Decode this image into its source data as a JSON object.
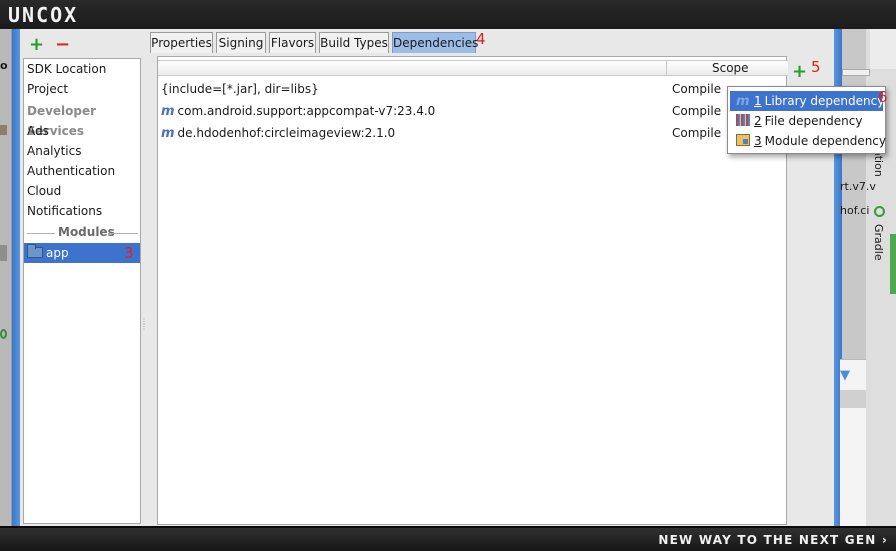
{
  "brand": {
    "logo_text": "UNCOX",
    "tagline": "NEW WAY TO THE NEXT GEN ›"
  },
  "toolbar": {
    "add_symbol": "+",
    "remove_symbol": "−"
  },
  "sidebar": {
    "items": [
      {
        "label": "SDK Location"
      },
      {
        "label": "Project"
      },
      {
        "label": "Developer Services"
      },
      {
        "label": "Ads"
      },
      {
        "label": "Analytics"
      },
      {
        "label": "Authentication"
      },
      {
        "label": "Cloud"
      },
      {
        "label": "Notifications"
      }
    ],
    "modules_label": "Modules",
    "module": {
      "label": "app",
      "annotation": "3"
    }
  },
  "tabs": [
    {
      "label": "Properties"
    },
    {
      "label": "Signing"
    },
    {
      "label": "Flavors"
    },
    {
      "label": "Build Types"
    },
    {
      "label": "Dependencies",
      "active": true
    }
  ],
  "tab_annotation": "4",
  "table": {
    "scope_header": "Scope",
    "rows": [
      {
        "name": "{include=[*.jar], dir=libs}",
        "scope": "Compile",
        "icon": "none"
      },
      {
        "name": "com.android.support:appcompat-v7:23.4.0",
        "scope": "Compile",
        "icon": "maven-icon",
        "icon_glyph": "m"
      },
      {
        "name": "de.hdodenhof:circleimageview:2.1.0",
        "scope": "Compile",
        "icon": "maven-icon",
        "icon_glyph": "m"
      }
    ]
  },
  "add_dependency": {
    "symbol": "+",
    "annotation": "5"
  },
  "popup": {
    "items": [
      {
        "num": "1",
        "label": "Library dependency",
        "icon": "library-icon",
        "icon_glyph": "m"
      },
      {
        "num": "2",
        "label": "File dependency",
        "icon": "file-icon"
      },
      {
        "num": "3",
        "label": "Module dependency",
        "icon": "module-icon"
      }
    ],
    "annotation": "6"
  },
  "ide_right": {
    "code_line_1": "rt.v7.v",
    "code_line_2": "hof.ci",
    "vertical_tab_1": "ation",
    "vertical_tab_2": "Gradle"
  },
  "colors": {
    "accent": "#3d73cc",
    "frame": "#4a86d4",
    "annotation": "#e02020",
    "add_green": "#2a9a2a",
    "remove_red": "#d42a2a"
  }
}
